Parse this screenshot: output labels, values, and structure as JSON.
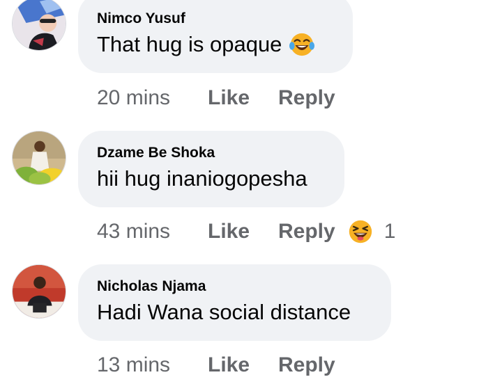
{
  "comments": [
    {
      "author": "Nimco Yusuf",
      "text": "That hug is opaque",
      "text_emoji": "tears-of-joy-emoji",
      "time": "20 mins",
      "like_label": "Like",
      "reply_label": "Reply"
    },
    {
      "author": "Dzame Be Shoka",
      "text": "hii hug inaniogopesha",
      "time": "43 mins",
      "like_label": "Like",
      "reply_label": "Reply",
      "reaction": {
        "icon": "haha-reaction-icon",
        "count": "1"
      }
    },
    {
      "author": "Nicholas Njama",
      "text": "Hadi Wana social distance",
      "time": "13 mins",
      "like_label": "Like",
      "reply_label": "Reply"
    }
  ],
  "colors": {
    "bubble_bg": "#f0f2f5",
    "meta_text": "#65676b",
    "body_text": "#050505",
    "emoji_yellow": "#f7b125"
  }
}
